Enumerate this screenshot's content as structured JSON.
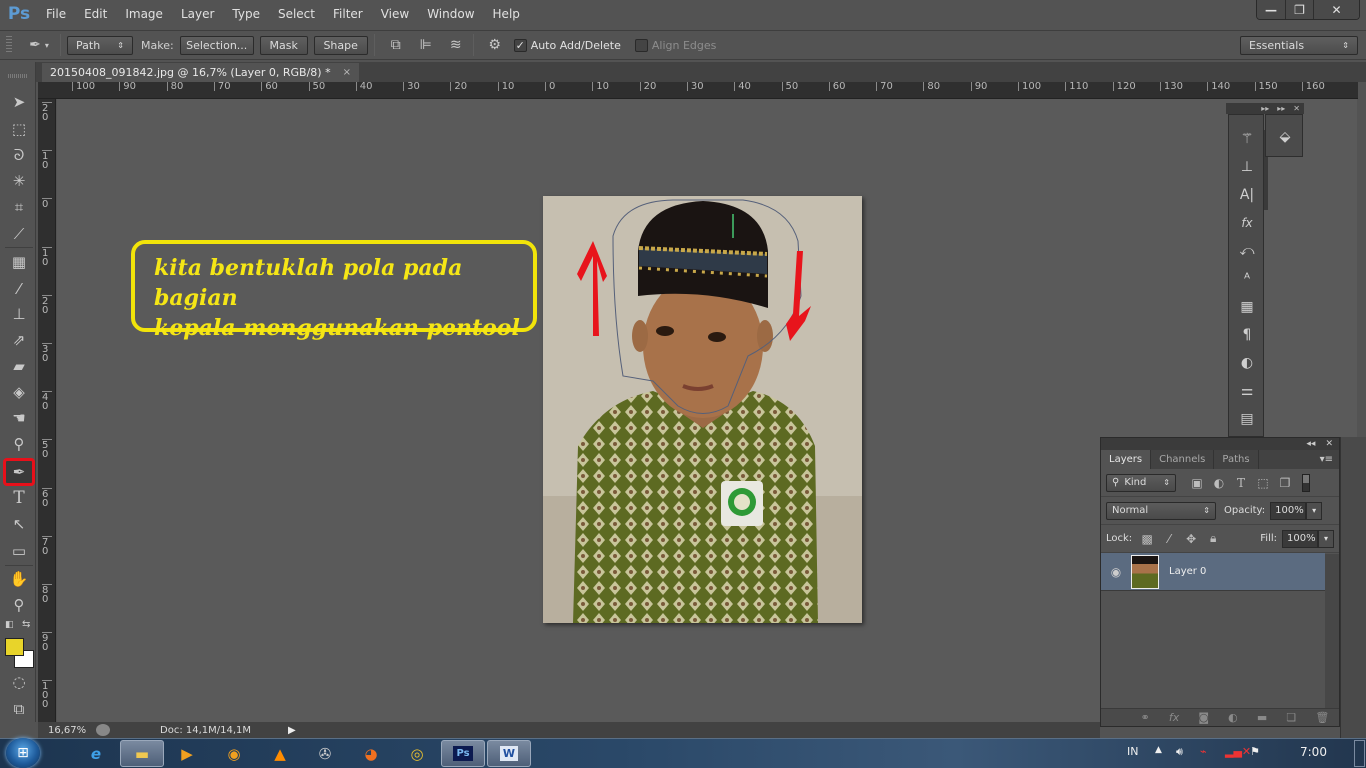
{
  "app": {
    "logo": "Ps"
  },
  "menu": [
    "File",
    "Edit",
    "Image",
    "Layer",
    "Type",
    "Select",
    "Filter",
    "View",
    "Window",
    "Help"
  ],
  "window_controls": {
    "minimize": "—",
    "restore": "❐",
    "close": "✕"
  },
  "options_bar": {
    "tool_icon": "pen-tool-icon",
    "mode_select": "Path",
    "make_label": "Make:",
    "selection_button": "Selection...",
    "mask_button": "Mask",
    "shape_button": "Shape",
    "auto_add_delete": {
      "label": "Auto Add/Delete",
      "checked": true
    },
    "align_edges": {
      "label": "Align Edges",
      "checked": false
    },
    "workspace_select": "Essentials"
  },
  "document": {
    "tab_title": "20150408_091842.jpg @ 16,7% (Layer 0, RGB/8) *",
    "close": "×"
  },
  "rulers": {
    "top": [
      "100",
      "90",
      "80",
      "70",
      "60",
      "50",
      "40",
      "30",
      "20",
      "10",
      "0",
      "10",
      "20",
      "30",
      "40",
      "50",
      "60",
      "70",
      "80",
      "90",
      "100",
      "110",
      "120",
      "130",
      "140",
      "150",
      "160"
    ],
    "left": [
      "20",
      "10",
      "0",
      "10",
      "20",
      "30",
      "40",
      "50",
      "60",
      "70",
      "80",
      "90",
      "100"
    ]
  },
  "annotation": {
    "line1": "kita bentuklah pola pada bagian",
    "line2": "kepala menggunakan pentool",
    "color": "#f5e616"
  },
  "tools": [
    "move-tool",
    "marquee-tool",
    "lasso-tool",
    "magic-wand-tool",
    "crop-tool",
    "eyedropper-tool",
    "healing-brush-tool",
    "brush-tool",
    "clone-stamp-tool",
    "history-brush-tool",
    "eraser-tool",
    "paint-bucket-tool",
    "smudge-tool",
    "dodge-tool",
    "pen-tool",
    "type-tool",
    "path-selection-tool",
    "rectangle-tool",
    "hand-tool",
    "zoom-tool"
  ],
  "active_tool": "pen-tool",
  "colors": {
    "foreground": "#e8d42a",
    "background": "#ffffff",
    "highlight": "#e8101a"
  },
  "layers_panel": {
    "tabs": [
      "Layers",
      "Channels",
      "Paths"
    ],
    "active_tab": "Layers",
    "filter_select": "Kind",
    "blend_mode": "Normal",
    "opacity_label": "Opacity:",
    "opacity_value": "100%",
    "lock_label": "Lock:",
    "fill_label": "Fill:",
    "fill_value": "100%",
    "layers": [
      {
        "name": "Layer 0",
        "visible": true,
        "selected": true
      }
    ]
  },
  "status_bar": {
    "zoom": "16,67%",
    "doc_size": "Doc: 14,1M/14,1M"
  },
  "taskbar": {
    "apps": [
      "internet-explorer",
      "file-explorer",
      "media-player",
      "aimp",
      "vlc",
      "movie-maker",
      "firefox",
      "chrome",
      "photoshop",
      "word"
    ],
    "lang": "IN",
    "clock": "7:00"
  }
}
